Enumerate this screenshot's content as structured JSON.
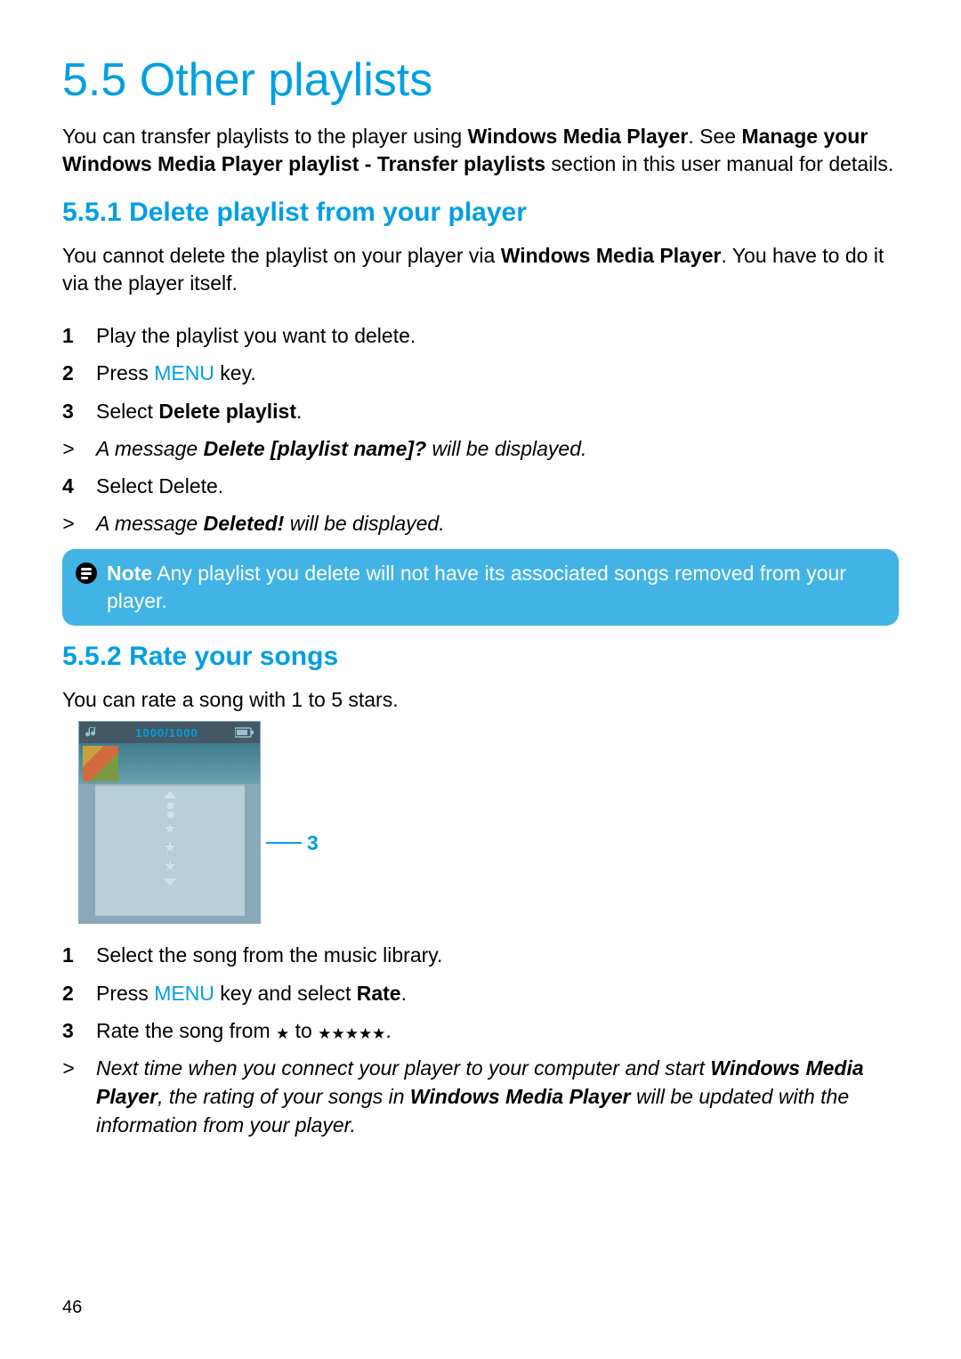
{
  "section": {
    "number": "5.5",
    "title": "Other playlists"
  },
  "intro": {
    "pre": "You can transfer playlists to the player using ",
    "wmp": "Windows Media Player",
    "see": ". See ",
    "manage": "Manage your Windows Media Player playlist - Transfer playlists",
    "post": " section in this user manual for details."
  },
  "sub1": {
    "number": "5.5.1",
    "title": "Delete playlist from your player",
    "intro_pre": "You cannot delete the playlist on your player via ",
    "intro_wmp": "Windows Media Player",
    "intro_post": ". You have to do it via the player itself.",
    "steps": {
      "s1_num": "1",
      "s1": "Play the playlist you want to delete.",
      "s2_num": "2",
      "s2_pre": "Press ",
      "s2_menu": "MENU",
      "s2_post": " key.",
      "s3_num": "3",
      "s3_pre": "Select ",
      "s3_bold": "Delete playlist",
      "s3_post": ".",
      "r1_sym": ">",
      "r1_pre": "A message ",
      "r1_bold": "Delete [playlist name]?",
      "r1_post": " will be displayed.",
      "s4_num": "4",
      "s4": "Select Delete.",
      "r2_sym": ">",
      "r2_pre": "A message ",
      "r2_bold": "Deleted!",
      "r2_post": " will be displayed."
    }
  },
  "note": {
    "label": "Note",
    "text": " Any playlist you delete will not have its associated songs removed from your player."
  },
  "sub2": {
    "number": "5.5.2",
    "title": "Rate your songs",
    "intro": "You can rate a song with 1 to 5 stars.",
    "player_counter": "1000/1000",
    "callout": "3",
    "steps": {
      "s1_num": "1",
      "s1": "Select the song from the music library.",
      "s2_num": "2",
      "s2_pre": "Press ",
      "s2_menu": "MENU",
      "s2_mid": " key and select ",
      "s2_bold": "Rate",
      "s2_post": ".",
      "s3_num": "3",
      "s3_pre": "Rate the song from ",
      "s3_mid": " to ",
      "s3_post": ".",
      "r1_sym": ">",
      "r1_a": "Next time when you connect your player to your computer and start ",
      "r1_wmp1": "Windows Media Player",
      "r1_b": ", the rating of your songs in ",
      "r1_wmp2": "Windows Media Player",
      "r1_c": " will be updated with the information from your player."
    }
  },
  "stars": {
    "one": "★",
    "five": "★★★★★"
  },
  "page_number": "46"
}
